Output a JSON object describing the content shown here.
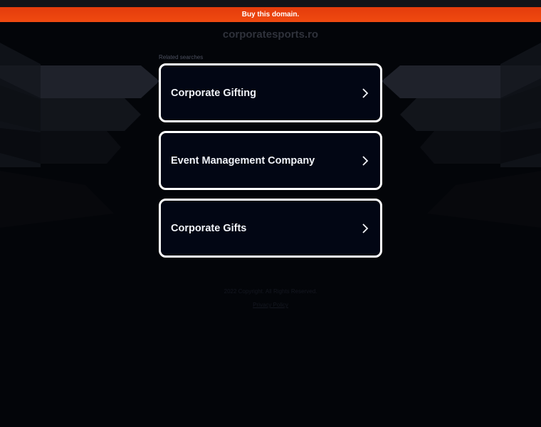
{
  "banner": {
    "label": "Buy this domain."
  },
  "domain": "corporatesports.ro",
  "related": {
    "label": "Related searches",
    "items": [
      {
        "label": "Corporate Gifting"
      },
      {
        "label": "Event Management Company"
      },
      {
        "label": "Corporate Gifts"
      }
    ]
  },
  "footer": {
    "copyright": "2022 Copyright. All Rights Reserved.",
    "privacy": "Privacy Policy"
  },
  "colors": {
    "background": "#030509",
    "banner": "#ea4410",
    "card_border": "#ffffff",
    "card_fill": "#020614"
  },
  "icons": {
    "result_arrow": "chevron-right-icon"
  }
}
